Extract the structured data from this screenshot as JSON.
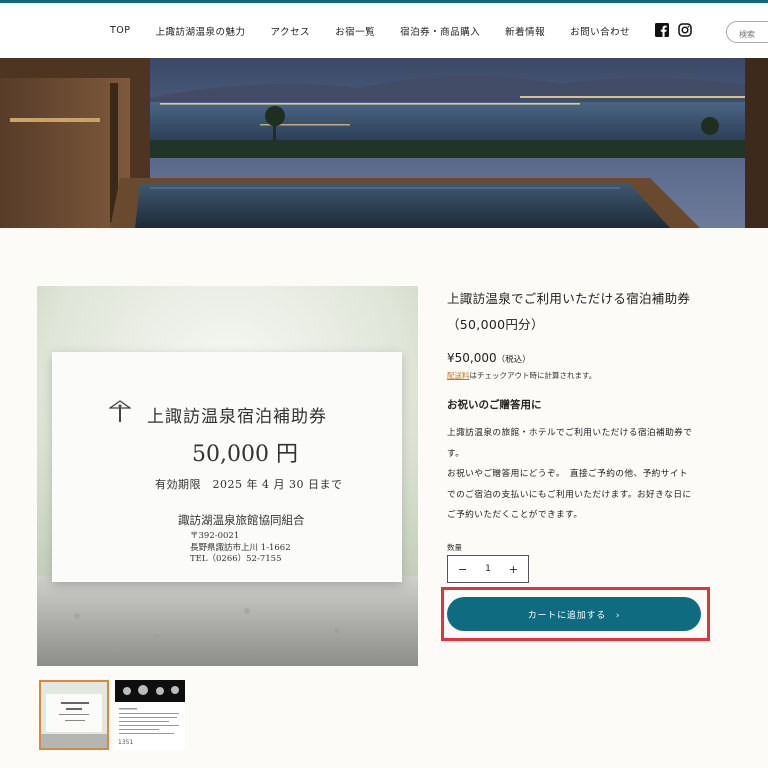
{
  "nav": {
    "items": [
      "TOP",
      "上諏訪湖温泉の魅力",
      "アクセス",
      "お宿一覧",
      "宿泊券・商品購入",
      "新着情報",
      "お問い合わせ"
    ]
  },
  "search": {
    "placeholder": "検索"
  },
  "product": {
    "title_line1": "上諏訪温泉でご利用いただける宿泊補助券",
    "title_line2": "（50,000円分）",
    "price": "¥50,000",
    "tax_note": "（税込）",
    "shipping_link": "配送料",
    "shipping_text": "はチェックアウト時に計算されます。",
    "subheading": "お祝いのご贈答用に",
    "desc_lines": [
      "上諏訪温泉の旅館・ホテルでご利用いただける宿泊補助券で",
      "す。",
      "お祝いやご贈答用にどうぞ。　直接ご予約の他、予約サイト",
      "でのご宿泊の支払いにもご利用いただけます。お好きな日に",
      "ご予約いただくことができます。"
    ],
    "qty_label": "数量",
    "qty_value": "1",
    "minus": "−",
    "plus": "+",
    "cart_button": "カートに追加する　›"
  },
  "voucher": {
    "title": "上諏訪温泉宿泊補助券",
    "amount": "50,000 円",
    "valid": "有効期限　2025 年 4 月 30 日まで",
    "org": "諏訪湖温泉旅館協同組合",
    "addr1": "〒392-0021",
    "addr2": "長野県諏訪市上川 1-1662",
    "addr3": "TEL（0266）52-7155"
  },
  "thumb2_caption": "1351",
  "colors": {
    "accent": "#0f6c80",
    "highlight": "#e4333a",
    "thumb_active": "#d8893d",
    "link": "#c7761a"
  }
}
